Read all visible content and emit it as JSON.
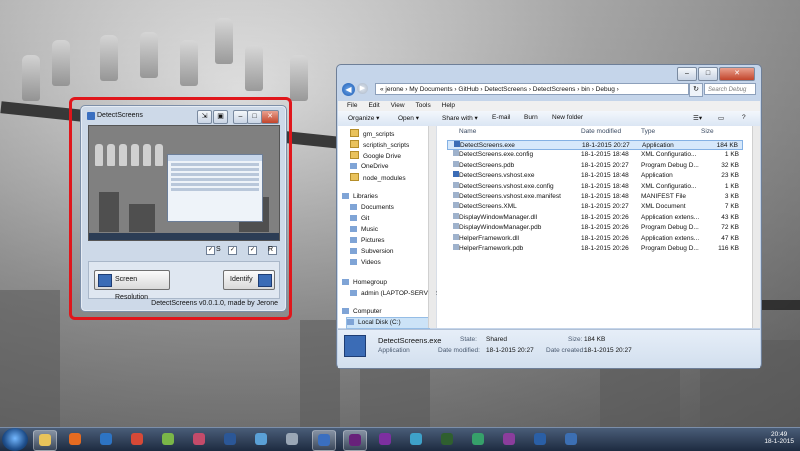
{
  "detect_window": {
    "title": "DetectScreens",
    "check_labels": [
      "S",
      "",
      "",
      "R"
    ],
    "screen_resolution_label": "Screen Resolution",
    "identify_label": "Identify",
    "credit": "DetectScreens v0.0.1.0, made by Jerone"
  },
  "explorer": {
    "address_path": "«  jerone  ›  My Documents  ›  GitHub  ›  DetectScreens  ›  DetectScreens  ›  bin  ›  Debug  ›",
    "search_placeholder": "Search Debug",
    "menu": [
      "File",
      "Edit",
      "View",
      "Tools",
      "Help"
    ],
    "toolbar": {
      "organize": "Organize ▾",
      "open": "Open ▾",
      "share_with": "Share with ▾",
      "email": "E-mail",
      "burn": "Burn",
      "new_folder": "New folder"
    },
    "nav": [
      {
        "label": "gm_scripts",
        "kind": "folder"
      },
      {
        "label": "scriptish_scripts",
        "kind": "folder"
      },
      {
        "label": "Google Drive",
        "kind": "folder"
      },
      {
        "label": "OneDrive",
        "kind": "cloud"
      },
      {
        "label": "node_modules",
        "kind": "folder"
      },
      {
        "label": "Libraries",
        "kind": "library"
      },
      {
        "label": "Documents",
        "kind": "library"
      },
      {
        "label": "Git",
        "kind": "library"
      },
      {
        "label": "Music",
        "kind": "library"
      },
      {
        "label": "Pictures",
        "kind": "library"
      },
      {
        "label": "Subversion",
        "kind": "library"
      },
      {
        "label": "Videos",
        "kind": "library"
      },
      {
        "label": "Homegroup",
        "kind": "homegroup"
      },
      {
        "label": "admin (LAPTOP-SERVER)",
        "kind": "user"
      },
      {
        "label": "Computer",
        "kind": "computer"
      },
      {
        "label": "Local Disk (C:)",
        "kind": "drive"
      }
    ],
    "columns": {
      "name": "Name",
      "date": "Date modified",
      "type": "Type",
      "size": "Size"
    },
    "files": [
      {
        "name": "DetectScreens.exe",
        "date": "18-1-2015 20:27",
        "type": "Application",
        "size": "184 KB"
      },
      {
        "name": "DetectScreens.exe.config",
        "date": "18-1-2015 18:48",
        "type": "XML Configuratio...",
        "size": "1 KB"
      },
      {
        "name": "DetectScreens.pdb",
        "date": "18-1-2015 20:27",
        "type": "Program Debug D...",
        "size": "32 KB"
      },
      {
        "name": "DetectScreens.vshost.exe",
        "date": "18-1-2015 18:48",
        "type": "Application",
        "size": "23 KB"
      },
      {
        "name": "DetectScreens.vshost.exe.config",
        "date": "18-1-2015 18:48",
        "type": "XML Configuratio...",
        "size": "1 KB"
      },
      {
        "name": "DetectScreens.vshost.exe.manifest",
        "date": "18-1-2015 18:48",
        "type": "MANIFEST File",
        "size": "3 KB"
      },
      {
        "name": "DetectScreens.XML",
        "date": "18-1-2015 20:27",
        "type": "XML Document",
        "size": "7 KB"
      },
      {
        "name": "DisplayWindowManager.dll",
        "date": "18-1-2015 20:26",
        "type": "Application extens...",
        "size": "43 KB"
      },
      {
        "name": "DisplayWindowManager.pdb",
        "date": "18-1-2015 20:26",
        "type": "Program Debug D...",
        "size": "72 KB"
      },
      {
        "name": "HelperFramework.dll",
        "date": "18-1-2015 20:26",
        "type": "Application extens...",
        "size": "47 KB"
      },
      {
        "name": "HelperFramework.pdb",
        "date": "18-1-2015 20:26",
        "type": "Program Debug D...",
        "size": "116 KB"
      }
    ],
    "details": {
      "filename": "DetectScreens.exe",
      "kind": "Application",
      "state_label": "State:",
      "state_value": "Shared",
      "modified_label": "Date modified:",
      "modified_value": "18-1-2015 20:27",
      "size_label": "Size:",
      "size_value": "184 KB",
      "created_label": "Date created:",
      "created_value": "18-1-2015 20:27"
    }
  },
  "taskbar": {
    "time": "20:49",
    "date": "18-1-2015",
    "apps": [
      {
        "name": "explorer-icon",
        "color": "#e8c35a"
      },
      {
        "name": "firefox-icon",
        "color": "#e56b21"
      },
      {
        "name": "ie-icon",
        "color": "#2d74c4"
      },
      {
        "name": "chrome-icon",
        "color": "#d64937"
      },
      {
        "name": "notepadpp-icon",
        "color": "#7ab648"
      },
      {
        "name": "paint-icon",
        "color": "#c44b6a"
      },
      {
        "name": "word-icon",
        "color": "#2b5797"
      },
      {
        "name": "notepad-icon",
        "color": "#5aa0d6"
      },
      {
        "name": "calculator-icon",
        "color": "#9aa7b6"
      },
      {
        "name": "detectscreens-icon",
        "color": "#3a6fc0"
      },
      {
        "name": "visualstudio-icon",
        "color": "#68217a"
      },
      {
        "name": "visualstudio2-icon",
        "color": "#7d2fa0"
      },
      {
        "name": "network-icon",
        "color": "#3ea1c9"
      },
      {
        "name": "terminal-icon",
        "color": "#2f5f2f"
      },
      {
        "name": "sourcetree-icon",
        "color": "#36a06a"
      },
      {
        "name": "record-icon",
        "color": "#8b3d9c"
      },
      {
        "name": "powershell-icon",
        "color": "#2a5fa6"
      },
      {
        "name": "display-icon",
        "color": "#3c6fb3"
      }
    ]
  }
}
